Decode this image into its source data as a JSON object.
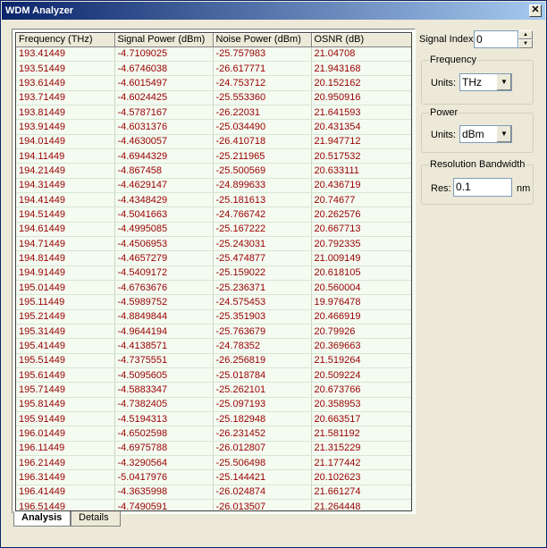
{
  "window": {
    "title": "WDM Analyzer",
    "close_glyph": "✕"
  },
  "grid": {
    "headers": [
      "Frequency (THz)",
      "Signal Power (dBm)",
      "Noise Power (dBm)",
      "OSNR (dB)"
    ],
    "rows": [
      [
        "193.41449",
        "-4.7109025",
        "-25.757983",
        "21.04708"
      ],
      [
        "193.51449",
        "-4.6746038",
        "-26.617771",
        "21.943168"
      ],
      [
        "193.61449",
        "-4.6015497",
        "-24.753712",
        "20.152162"
      ],
      [
        "193.71449",
        "-4.6024425",
        "-25.553360",
        "20.950916"
      ],
      [
        "193.81449",
        "-4.5787167",
        "-26.22031",
        "21.641593"
      ],
      [
        "193.91449",
        "-4.6031376",
        "-25.034490",
        "20.431354"
      ],
      [
        "194.01449",
        "-4.4630057",
        "-26.410718",
        "21.947712"
      ],
      [
        "194.11449",
        "-4.6944329",
        "-25.211965",
        "20.517532"
      ],
      [
        "194.21449",
        "-4.867458",
        "-25.500569",
        "20.633111"
      ],
      [
        "194.31449",
        "-4.4629147",
        "-24.899633",
        "20.436719"
      ],
      [
        "194.41449",
        "-4.4348429",
        "-25.181613",
        "20.74677"
      ],
      [
        "194.51449",
        "-4.5041663",
        "-24.766742",
        "20.262576"
      ],
      [
        "194.61449",
        "-4.4995085",
        "-25.167222",
        "20.667713"
      ],
      [
        "194.71449",
        "-4.4506953",
        "-25.243031",
        "20.792335"
      ],
      [
        "194.81449",
        "-4.4657279",
        "-25.474877",
        "21.009149"
      ],
      [
        "194.91449",
        "-4.5409172",
        "-25.159022",
        "20.618105"
      ],
      [
        "195.01449",
        "-4.6763676",
        "-25.236371",
        "20.560004"
      ],
      [
        "195.11449",
        "-4.5989752",
        "-24.575453",
        "19.976478"
      ],
      [
        "195.21449",
        "-4.8849844",
        "-25.351903",
        "20.466919"
      ],
      [
        "195.31449",
        "-4.9644194",
        "-25.763679",
        "20.79926"
      ],
      [
        "195.41449",
        "-4.4138571",
        "-24.78352",
        "20.369663"
      ],
      [
        "195.51449",
        "-4.7375551",
        "-26.256819",
        "21.519264"
      ],
      [
        "195.61449",
        "-4.5095605",
        "-25.018784",
        "20.509224"
      ],
      [
        "195.71449",
        "-4.5883347",
        "-25.262101",
        "20.673766"
      ],
      [
        "195.81449",
        "-4.7382405",
        "-25.097193",
        "20.358953"
      ],
      [
        "195.91449",
        "-4.5194313",
        "-25.182948",
        "20.663517"
      ],
      [
        "196.01449",
        "-4.6502598",
        "-26.231452",
        "21.581192"
      ],
      [
        "196.11449",
        "-4.6975788",
        "-26.012807",
        "21.315229"
      ],
      [
        "196.21449",
        "-4.3290564",
        "-25.506498",
        "21.177442"
      ],
      [
        "196.31449",
        "-5.0417976",
        "-25.144421",
        "20.102623"
      ],
      [
        "196.41449",
        "-4.3635998",
        "-26.024874",
        "21.661274"
      ],
      [
        "196.51449",
        "-4.7490591",
        "-26.013507",
        "21.264448"
      ]
    ]
  },
  "tabs": [
    {
      "label": "Analysis",
      "active": true
    },
    {
      "label": "Details",
      "active": false
    }
  ],
  "signal_index": {
    "label": "Signal Index:",
    "value": "0"
  },
  "frequency": {
    "group_label": "Frequency",
    "units_label": "Units:",
    "selected": "THz"
  },
  "power": {
    "group_label": "Power",
    "units_label": "Units:",
    "selected": "dBm"
  },
  "resolution": {
    "group_label": "Resolution Bandwidth",
    "res_label": "Res:",
    "value": "0.1",
    "unit": "nm"
  },
  "colors": {
    "title_start": "#0a246a",
    "title_end": "#a6caf0",
    "cell_text": "#990000",
    "grid_bg": "#f4fbf1"
  }
}
